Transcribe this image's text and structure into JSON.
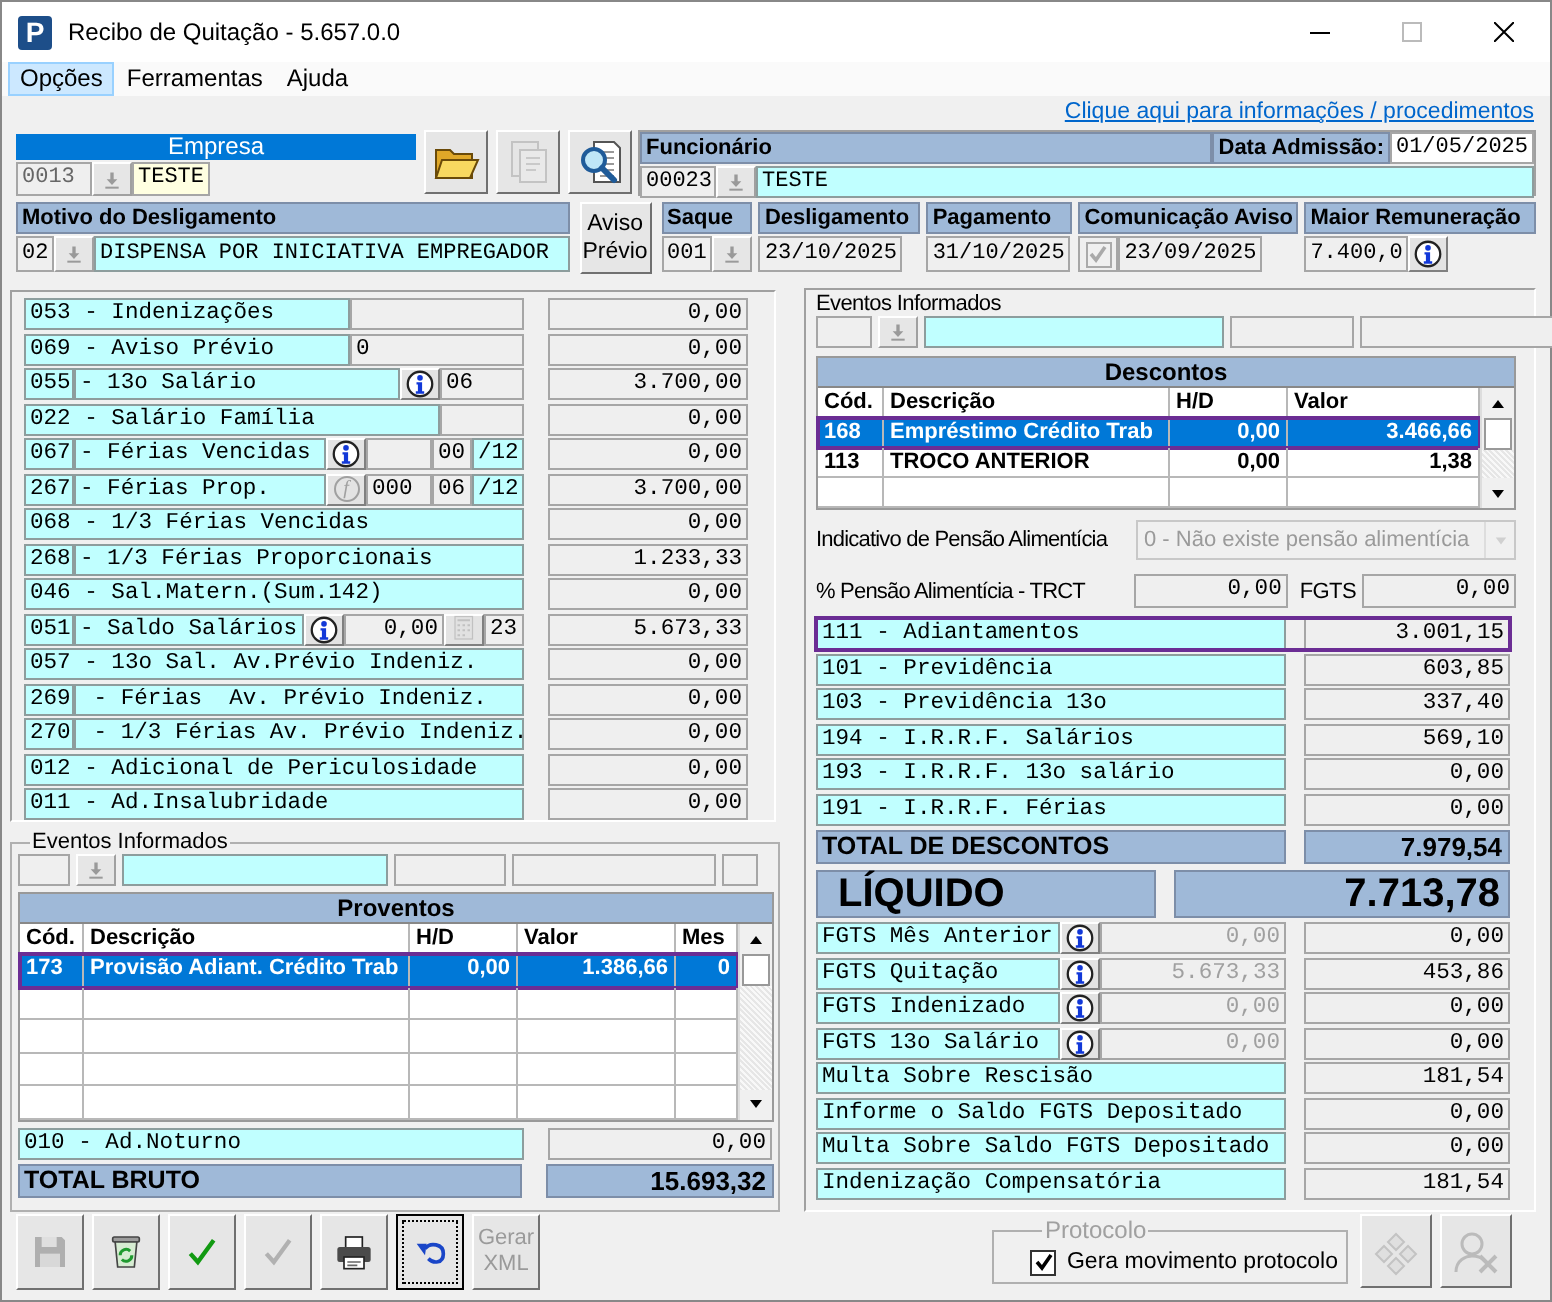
{
  "window": {
    "icon_letter": "P",
    "title": "Recibo de Quitação - 5.657.0.0"
  },
  "menu": [
    {
      "label": "Opções",
      "selected": true
    },
    {
      "label": "Ferramentas",
      "selected": false
    },
    {
      "label": "Ajuda",
      "selected": false
    }
  ],
  "help_link": "Clique aqui para informações / procedimentos",
  "empresa": {
    "title": "Empresa",
    "code": "0013",
    "name": "TESTE"
  },
  "top_buttons": [
    {
      "kind": "folder",
      "disabled": false
    },
    {
      "kind": "report",
      "disabled": true
    },
    {
      "kind": "search",
      "disabled": false
    }
  ],
  "funcionario": {
    "title": "Funcionário",
    "code": "00023",
    "name": "TESTE",
    "admission_label": "Data Admissão:",
    "admission_date": "01/05/2025"
  },
  "motivo": {
    "title": "Motivo do Desligamento",
    "code": "02",
    "description": "DISPENSA POR INICIATIVA EMPREGADOR"
  },
  "aviso_previo_button": "Aviso Prévio",
  "saque": {
    "title": "Saque",
    "code": "001"
  },
  "desligamento": {
    "title": "Desligamento",
    "date": "23/10/2025"
  },
  "pagamento": {
    "title": "Pagamento",
    "date": "31/10/2025"
  },
  "comunicacao_aviso": {
    "title": "Comunicação Aviso",
    "checked": true,
    "disabled": true,
    "date": "23/09/2025"
  },
  "maior_remuneracao": {
    "title": "Maior Remuneração",
    "value": "7.400,0"
  },
  "earnings": {
    "rows": [
      {
        "label": "053 - Indenizações",
        "parts": [
          {
            "kind": "wide_field"
          }
        ],
        "value": "0,00"
      },
      {
        "label": "069 - Aviso Prévio",
        "parts": [
          {
            "kind": "wide_field",
            "text": "0"
          }
        ],
        "value": "0,00"
      },
      {
        "code": "055",
        "label": "- 13o Salário",
        "parts": [
          {
            "kind": "info_button"
          },
          {
            "kind": "field",
            "text": "06"
          }
        ],
        "value": "3.700,00"
      },
      {
        "label": "022 - Salário Família",
        "parts": [
          {
            "kind": "field"
          }
        ],
        "value": "0,00"
      },
      {
        "code": "067",
        "label": "- Férias Vencidas",
        "parts": [
          {
            "kind": "info_button"
          },
          {
            "kind": "narrow_field"
          },
          {
            "kind": "month_field",
            "text": "00"
          },
          {
            "kind": "fraction",
            "text": "/12"
          }
        ],
        "value": "0,00"
      },
      {
        "code": "267",
        "label": "- Férias Prop.",
        "parts": [
          {
            "kind": "formula_button",
            "symbol": "f",
            "disabled": true
          },
          {
            "kind": "narrow_field",
            "text": "000"
          },
          {
            "kind": "month_field",
            "text": "06"
          },
          {
            "kind": "fraction",
            "text": "/12"
          }
        ],
        "value": "3.700,00"
      },
      {
        "label": "068 - 1/3 Férias Vencidas",
        "value": "0,00"
      },
      {
        "code": "268",
        "label": "- 1/3 Férias Proporcionais",
        "value": "1.233,33"
      },
      {
        "label": "046 - Sal.Matern.(Sum.142)",
        "value": "0,00"
      },
      {
        "code": "051",
        "label": "- Saldo Salários",
        "parts": [
          {
            "kind": "info_button"
          },
          {
            "kind": "amount_field",
            "text": "0,00",
            "disabled": false
          },
          {
            "kind": "calculator_button",
            "disabled": true
          },
          {
            "kind": "month_field",
            "text": "23"
          }
        ],
        "value": "5.673,33"
      },
      {
        "label": "057 - 13o Sal. Av.Prévio Indeniz.",
        "value": "0,00"
      },
      {
        "code": "269",
        "label": " - Férias  Av. Prévio Indeniz.",
        "value": "0,00"
      },
      {
        "code": "270",
        "label": " - 1/3 Férias Av. Prévio Indeniz.",
        "value": "0,00"
      },
      {
        "label": "012 - Adicional de Periculosidade",
        "value": "0,00"
      },
      {
        "label": "011 - Ad.Insalubridade",
        "value": "0,00"
      }
    ],
    "events_title": "Eventos Informados",
    "table": {
      "title": "Proventos",
      "columns": [
        "Cód.",
        "Descrição",
        "H/D",
        "Valor",
        "Mes"
      ],
      "rows": [
        {
          "cells": [
            "173",
            "Provisão Adiant. Crédito Trab",
            "0,00",
            "1.386,66",
            "0"
          ],
          "selected": true,
          "highlighted": true
        }
      ]
    },
    "extra_row": {
      "label": "010 - Ad.Noturno",
      "value": "0,00"
    },
    "total": {
      "label": "TOTAL BRUTO",
      "value": "15.693,32"
    }
  },
  "deductions": {
    "events_title": "Eventos Informados",
    "table": {
      "title": "Descontos",
      "columns": [
        "Cód.",
        "Descrição",
        "H/D",
        "Valor"
      ],
      "rows": [
        {
          "cells": [
            "168",
            "Empréstimo Crédito Trab",
            "0,00",
            "3.466,66"
          ],
          "selected": true,
          "highlighted": true
        },
        {
          "cells": [
            "113",
            "TROCO ANTERIOR",
            "0,00",
            "1,38"
          ],
          "selected": false,
          "highlighted": false
        }
      ]
    },
    "pension_indicator": {
      "label": "Indicativo de Pensão Alimentícia",
      "value": "0 - Não existe pensão alimentícia",
      "disabled": true
    },
    "pension_percent": {
      "label": "% Pensão Alimentícia - TRCT",
      "value": "0,00"
    },
    "fgts": {
      "label": "FGTS",
      "value": "0,00"
    },
    "rows": [
      {
        "label": "111 - Adiantamentos",
        "value": "3.001,15",
        "highlighted": true
      },
      {
        "label": "101 - Previdência",
        "value": "603,85",
        "highlighted": false
      },
      {
        "label": "103 - Previdência 13o",
        "value": "337,40",
        "highlighted": false
      },
      {
        "label": "194 - I.R.R.F. Salários",
        "value": "569,10",
        "highlighted": false
      },
      {
        "label": "193 - I.R.R.F. 13o salário",
        "value": "0,00",
        "highlighted": false
      },
      {
        "label": "191 - I.R.R.F. Férias",
        "value": "0,00",
        "highlighted": false
      }
    ],
    "total": {
      "label": "TOTAL DE DESCONTOS",
      "value": "7.979,54"
    },
    "net": {
      "label": "LÍQUIDO",
      "value": "7.713,78"
    },
    "fgts_rows": [
      {
        "label": "FGTS Mês Anterior",
        "parts": [
          {
            "kind": "info_button"
          },
          {
            "kind": "amount_field",
            "text": "0,00",
            "disabled": true
          }
        ],
        "value": "0,00"
      },
      {
        "label": "FGTS Quitação",
        "parts": [
          {
            "kind": "info_button"
          },
          {
            "kind": "amount_field",
            "text": "5.673,33",
            "disabled": true
          }
        ],
        "value": "453,86"
      },
      {
        "label": "FGTS Indenizado",
        "parts": [
          {
            "kind": "info_button"
          },
          {
            "kind": "amount_field",
            "text": "0,00",
            "disabled": true
          }
        ],
        "value": "0,00"
      },
      {
        "label": "FGTS 13o Salário",
        "parts": [
          {
            "kind": "info_button"
          },
          {
            "kind": "amount_field",
            "text": "0,00",
            "disabled": true
          }
        ],
        "value": "0,00"
      },
      {
        "label": "Multa Sobre Rescisão",
        "value": "181,54"
      },
      {
        "label": "Informe o Saldo FGTS Depositado",
        "value": "0,00"
      },
      {
        "label": "Multa Sobre Saldo FGTS Depositado",
        "value": "0,00"
      },
      {
        "label": "Indenização Compensatória",
        "value": "181,54"
      }
    ]
  },
  "toolbar": [
    {
      "kind": "save",
      "disabled": true,
      "focused": false
    },
    {
      "kind": "recycle",
      "disabled": false,
      "focused": false
    },
    {
      "kind": "confirm",
      "disabled": false,
      "focused": false
    },
    {
      "kind": "confirm",
      "disabled": true,
      "focused": false
    },
    {
      "kind": "print",
      "disabled": false,
      "focused": false
    },
    {
      "kind": "undo",
      "disabled": false,
      "focused": true
    },
    {
      "kind": "text",
      "label": "Gerar XML",
      "disabled": true,
      "focused": false
    }
  ],
  "protocol": {
    "title": "Protocolo",
    "disabled": true,
    "checkbox_label": "Gera movimento protocolo",
    "checked": true
  },
  "side_buttons": [
    {
      "kind": "network",
      "disabled": true
    },
    {
      "kind": "user_remove",
      "disabled": true
    }
  ]
}
